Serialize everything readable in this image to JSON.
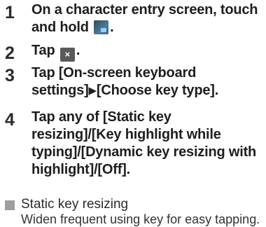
{
  "steps": [
    {
      "number": "1",
      "text_before": "On a character entry screen, touch and hold ",
      "icon": "keyboard-settings-icon",
      "text_after": "."
    },
    {
      "number": "2",
      "text_before": "Tap ",
      "icon": "close-icon",
      "icon_glyph": "×",
      "text_after": "."
    },
    {
      "number": "3",
      "text_before": "Tap [On-screen keyboard settings]",
      "arrow": "▶",
      "text_after": "[Choose key type]."
    },
    {
      "number": "4",
      "text": "Tap any of [Static key resizing]/[Key highlight while typing]/[Dynamic key resizing with highlight]/[Off]."
    }
  ],
  "note": {
    "title": "Static key resizing",
    "description": "Widen frequent using key for easy tapping."
  },
  "colors": {
    "text": "#1e1e1e",
    "marker": "#9e9e9e",
    "close_icon_bg": "#5a5a5a",
    "keyboard_icon_bg": "#3a6884"
  }
}
